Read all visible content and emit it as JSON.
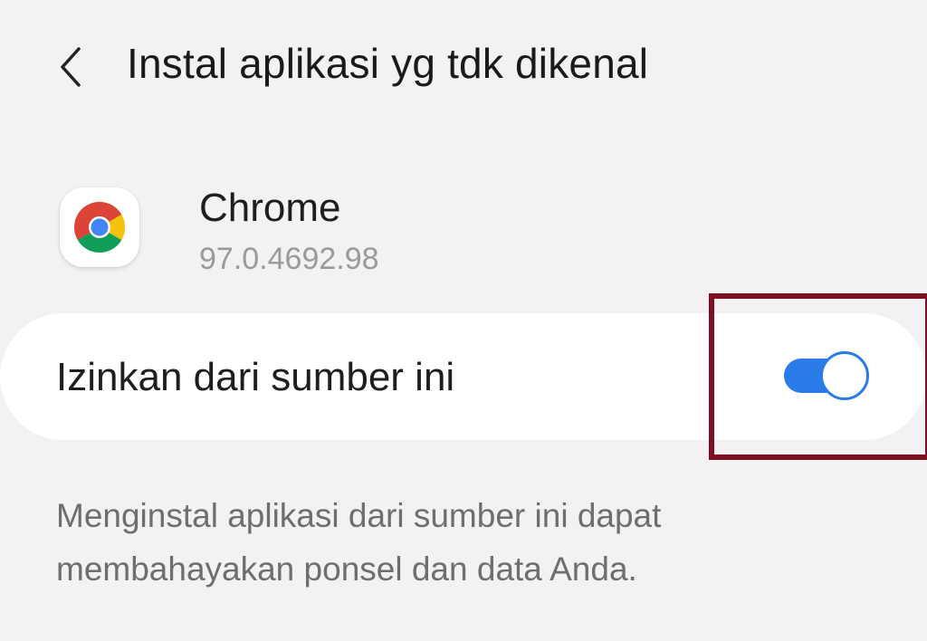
{
  "header": {
    "back_icon": "chevron-left-icon",
    "title": "Instal aplikasi yg tdk dikenal"
  },
  "app": {
    "icon": "chrome-icon",
    "name": "Chrome",
    "version": "97.0.4692.98"
  },
  "setting": {
    "label": "Izinkan dari sumber ini",
    "enabled": true
  },
  "description": {
    "line1": "Menginstal aplikasi dari sumber ini dapat",
    "line2": "membahayakan ponsel dan data Anda."
  },
  "colors": {
    "background": "#f2f2f2",
    "card": "#ffffff",
    "switch_on": "#2a7de8",
    "highlight": "#7f0f24",
    "chrome_red": "#db4437",
    "chrome_yellow": "#f4c20d",
    "chrome_green": "#0f9d58",
    "chrome_blue": "#4285f4"
  }
}
